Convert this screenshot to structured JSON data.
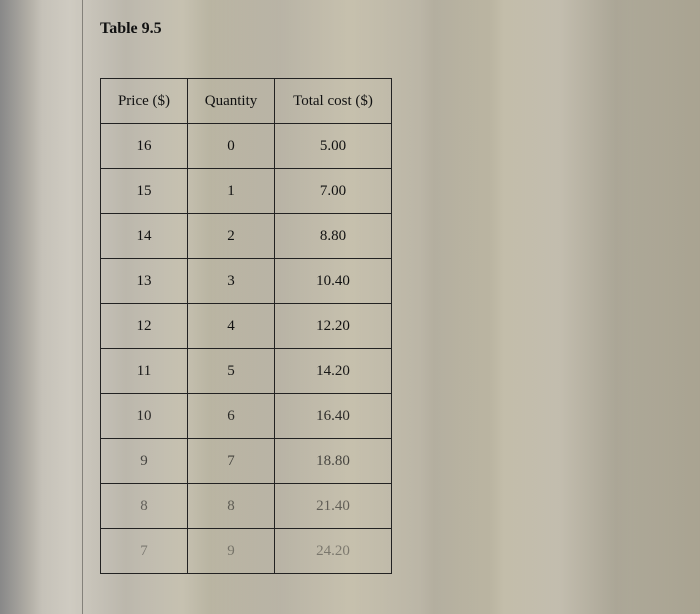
{
  "title": "Table 9.5",
  "columns": {
    "price": "Price ($)",
    "quantity": "Quantity",
    "total_cost": "Total cost ($)"
  },
  "rows": [
    {
      "price": "16",
      "quantity": "0",
      "total_cost": "5.00"
    },
    {
      "price": "15",
      "quantity": "1",
      "total_cost": "7.00"
    },
    {
      "price": "14",
      "quantity": "2",
      "total_cost": "8.80"
    },
    {
      "price": "13",
      "quantity": "3",
      "total_cost": "10.40"
    },
    {
      "price": "12",
      "quantity": "4",
      "total_cost": "12.20"
    },
    {
      "price": "11",
      "quantity": "5",
      "total_cost": "14.20"
    },
    {
      "price": "10",
      "quantity": "6",
      "total_cost": "16.40"
    },
    {
      "price": "9",
      "quantity": "7",
      "total_cost": "18.80"
    },
    {
      "price": "8",
      "quantity": "8",
      "total_cost": "21.40"
    },
    {
      "price": "7",
      "quantity": "9",
      "total_cost": "24.20"
    }
  ],
  "chart_data": {
    "type": "table",
    "title": "Table 9.5",
    "columns": [
      "Price ($)",
      "Quantity",
      "Total cost ($)"
    ],
    "data": [
      [
        16,
        0,
        5.0
      ],
      [
        15,
        1,
        7.0
      ],
      [
        14,
        2,
        8.8
      ],
      [
        13,
        3,
        10.4
      ],
      [
        12,
        4,
        12.2
      ],
      [
        11,
        5,
        14.2
      ],
      [
        10,
        6,
        16.4
      ],
      [
        9,
        7,
        18.8
      ],
      [
        8,
        8,
        21.4
      ],
      [
        7,
        9,
        24.2
      ]
    ]
  }
}
